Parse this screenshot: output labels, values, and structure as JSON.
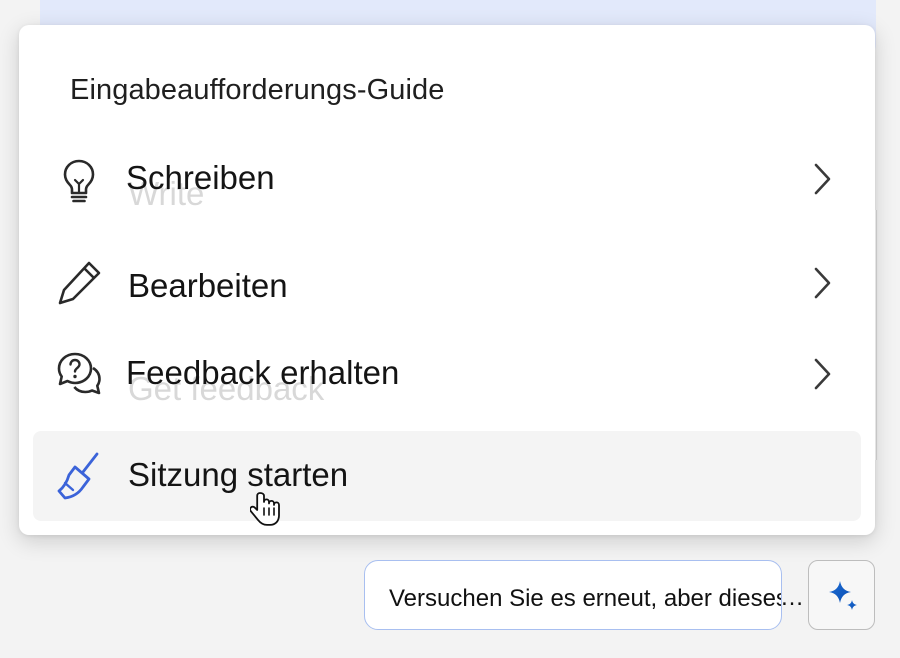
{
  "menu": {
    "title": "Eingabeaufforderungs-Guide",
    "items": [
      {
        "label": "Schreiben",
        "ghost": "Write",
        "icon": "lightbulb-icon",
        "has_submenu": true
      },
      {
        "label": "Bearbeiten",
        "icon": "pencil-icon",
        "has_submenu": true
      },
      {
        "label": "Feedback erhalten",
        "ghost": "Get feedback",
        "icon": "question-chat-icon",
        "has_submenu": true
      },
      {
        "label": "Sitzung starten",
        "icon": "broom-icon",
        "has_submenu": false,
        "hovered": true
      }
    ]
  },
  "suggestion": {
    "text": "Versuchen Sie es erneut, aber dieses Mal",
    "overflow": "…"
  },
  "colors": {
    "accent": "#3b63d9",
    "hover_bg": "#f4f4f4",
    "suggestion_border": "#a8bff0",
    "top_banner": "#e2e9fb"
  }
}
